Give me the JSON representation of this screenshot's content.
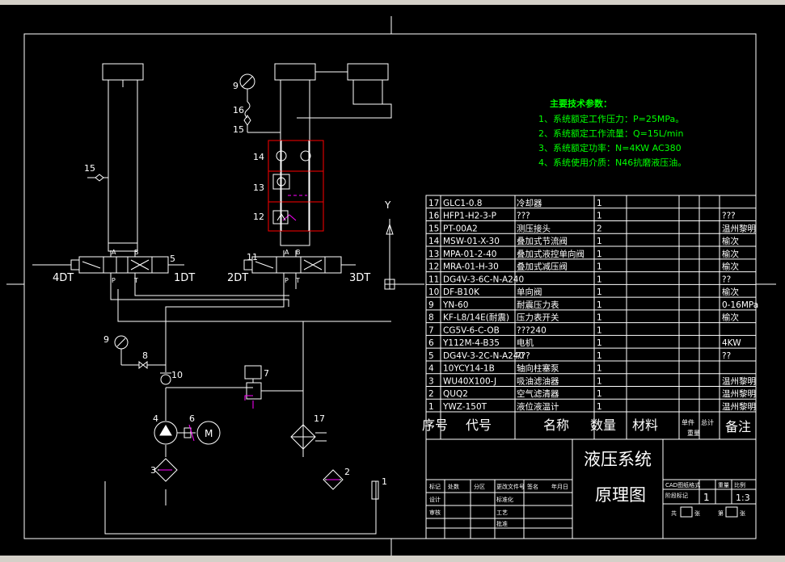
{
  "specs": {
    "heading": "主要技术参数：",
    "lines": [
      "1、系统额定工作压力：P=25MPa。",
      "2、系统额定工作流量：Q=15L/min",
      "3、系统额定功率：N=4KW   AC380",
      "4、系统使用介质：N46抗磨液压油。"
    ]
  },
  "axis": {
    "y_label": "Y"
  },
  "labels": {
    "dt4": "4DT",
    "dt1": "1DT",
    "dt2": "2DT",
    "dt3": "3DT",
    "n5": "5",
    "n11": "11",
    "n9a": "9",
    "n16": "16",
    "n15a": "15",
    "n14": "14",
    "n13": "13",
    "n12": "12",
    "n15b": "15",
    "n9b": "9",
    "n8": "8",
    "n10": "10",
    "n7": "7",
    "n4": "4",
    "n6": "6",
    "motor": "M",
    "n17": "17",
    "n3": "3",
    "n2": "2",
    "n1": "1",
    "port_a": "A",
    "port_b": "B",
    "port_p": "P",
    "port_t": "T"
  },
  "bom": {
    "rows": [
      {
        "no": "17",
        "code": "GLC1-0.8",
        "name": "冷却器",
        "qty": "1",
        "mat": "",
        "note": ""
      },
      {
        "no": "16",
        "code": "HFP1-H2-3-P",
        "name": "???",
        "qty": "1",
        "mat": "",
        "note": "???"
      },
      {
        "no": "15",
        "code": "PT-00A2",
        "name": "测压接头",
        "qty": "2",
        "mat": "",
        "note": "温州黎明"
      },
      {
        "no": "14",
        "code": "MSW-01-X-30",
        "name": "叠加式节流阀",
        "qty": "1",
        "mat": "",
        "note": "榆次"
      },
      {
        "no": "13",
        "code": "MPA-01-2-40",
        "name": "叠加式液控单向阀",
        "qty": "1",
        "mat": "",
        "note": "榆次"
      },
      {
        "no": "12",
        "code": "MRA-01-H-30",
        "name": "叠加式减压阀",
        "qty": "1",
        "mat": "",
        "note": "榆次"
      },
      {
        "no": "11",
        "code": "DG4V-3-6C-N-A240",
        "name": "",
        "qty": "1",
        "mat": "",
        "note": "??"
      },
      {
        "no": "10",
        "code": "DF-B10K",
        "name": "单向阀",
        "qty": "1",
        "mat": "",
        "note": "榆次"
      },
      {
        "no": "9",
        "code": "YN-60",
        "name": "耐震压力表",
        "qty": "1",
        "mat": "",
        "note": "0-16MPa"
      },
      {
        "no": "8",
        "code": "KF-L8/14E(耐震)",
        "name": "压力表开关",
        "qty": "1",
        "mat": "",
        "note": "榆次"
      },
      {
        "no": "7",
        "code": "CG5V-6-C-OB",
        "name": "???240",
        "qty": "1",
        "mat": "",
        "note": ""
      },
      {
        "no": "6",
        "code": "Y112M-4-B35",
        "name": "电机",
        "qty": "1",
        "mat": "",
        "note": "4KW"
      },
      {
        "no": "5",
        "code": "DG4V-3-2C-N-A240",
        "name": "???",
        "qty": "1",
        "mat": "",
        "note": "??"
      },
      {
        "no": "4",
        "code": "10YCY14-1B",
        "name": "轴向柱塞泵",
        "qty": "1",
        "mat": "",
        "note": ""
      },
      {
        "no": "3",
        "code": "WU40X100-J",
        "name": "吸油滤油器",
        "qty": "1",
        "mat": "",
        "note": "温州黎明"
      },
      {
        "no": "2",
        "code": "QUQ2",
        "name": "空气滤清器",
        "qty": "1",
        "mat": "",
        "note": "温州黎明"
      },
      {
        "no": "1",
        "code": "YWZ-150T",
        "name": "液位液温计",
        "qty": "1",
        "mat": "",
        "note": "温州黎明"
      }
    ],
    "header": {
      "no": "序号",
      "code": "代号",
      "name": "名称",
      "qty": "数量",
      "mat": "材料",
      "unit": "单件",
      "total": "总计",
      "weight": "重量",
      "note": "备注"
    }
  },
  "title_block": {
    "title1": "液压系统",
    "title2": "原理图",
    "sign_row": [
      "标记",
      "处数",
      "分区",
      "更改文件号",
      "签名",
      "年月日"
    ],
    "design": "设计",
    "std": "标准化",
    "check": "审核",
    "process": "工艺",
    "approve": "批准",
    "date_std": "年月日",
    "phase": "阶段标记",
    "weight": "重量",
    "ratio": "比例",
    "scale_val": "1:3",
    "qty_val": "1",
    "sheet": "共",
    "sheet2": "张",
    "page": "第",
    "page2": "张",
    "cad": "CAD图纸格式"
  }
}
